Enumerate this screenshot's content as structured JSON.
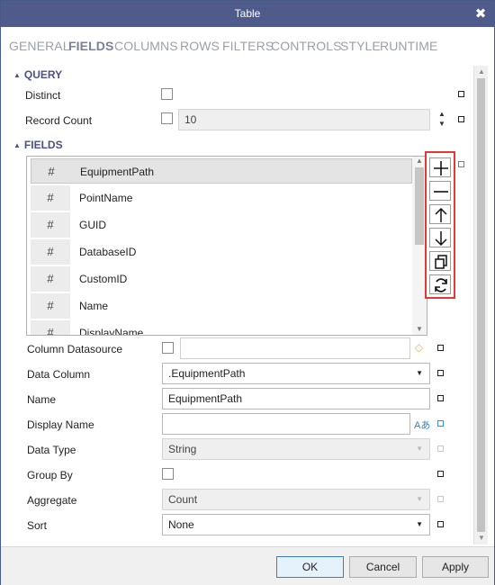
{
  "window": {
    "title": "Table",
    "close_glyph": "✖"
  },
  "tabs": [
    {
      "label": "GENERAL"
    },
    {
      "label": "FIELDS"
    },
    {
      "label": "COLUMNS"
    },
    {
      "label": "ROWS"
    },
    {
      "label": "FILTERS"
    },
    {
      "label": "CONTROLS"
    },
    {
      "label": "STYLE"
    },
    {
      "label": "RUNTIME"
    }
  ],
  "active_tab": "FIELDS",
  "query": {
    "header": "QUERY",
    "distinct_label": "Distinct",
    "distinct_checked": false,
    "record_count_label": "Record Count",
    "record_count_checked": false,
    "record_count_value": "10"
  },
  "fields": {
    "header": "FIELDS",
    "items": [
      {
        "icon": "#",
        "name": "EquipmentPath"
      },
      {
        "icon": "#",
        "name": "PointName"
      },
      {
        "icon": "#",
        "name": "GUID"
      },
      {
        "icon": "#",
        "name": "DatabaseID"
      },
      {
        "icon": "#",
        "name": "CustomID"
      },
      {
        "icon": "#",
        "name": "Name"
      },
      {
        "icon": "#",
        "name": "DisplayName"
      }
    ],
    "selected": "EquipmentPath",
    "toolbar": [
      "add-icon",
      "remove-icon",
      "move-up-icon",
      "move-down-icon",
      "duplicate-icon",
      "refresh-icon"
    ]
  },
  "properties": {
    "column_datasource_label": "Column Datasource",
    "column_datasource_checked": false,
    "column_datasource_value": "",
    "data_column_label": "Data Column",
    "data_column_value": ".EquipmentPath",
    "name_label": "Name",
    "name_value": "EquipmentPath",
    "display_name_label": "Display Name",
    "display_name_value": "",
    "display_name_icon": "Aあ",
    "data_type_label": "Data Type",
    "data_type_value": "String",
    "group_by_label": "Group By",
    "group_by_checked": false,
    "aggregate_label": "Aggregate",
    "aggregate_value": "Count",
    "sort_label": "Sort",
    "sort_value": "None"
  },
  "buttons": {
    "ok": "OK",
    "cancel": "Cancel",
    "apply": "Apply"
  },
  "colors": {
    "titlebar": "#4e5b8b",
    "section": "#4a5280",
    "highlight_border": "#e23838"
  }
}
